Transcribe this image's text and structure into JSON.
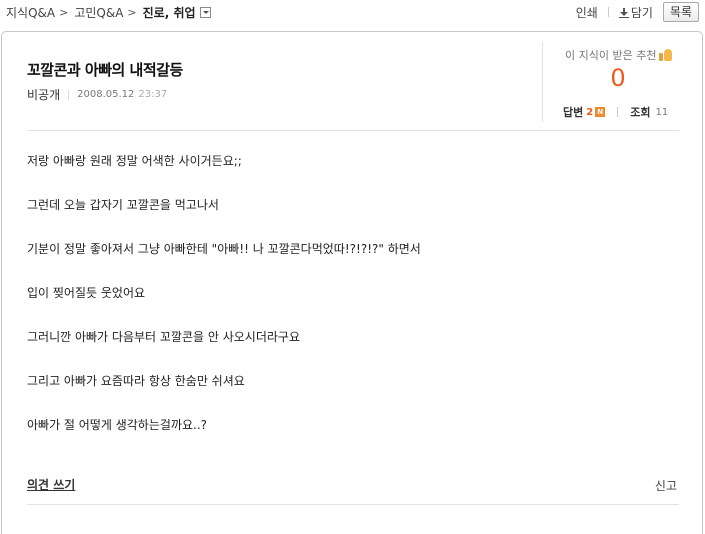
{
  "breadcrumb": {
    "items": [
      "지식Q&A",
      "고민Q&A"
    ],
    "separator": ">",
    "current": "진로, 취업"
  },
  "tools": {
    "print_label": "인쇄",
    "save_label": "담기",
    "list_label": "목록"
  },
  "question": {
    "title": "꼬깔콘과 아빠의 내적갈등",
    "author": "비공개",
    "date": "2008.05.12",
    "time": "23:37"
  },
  "recommend": {
    "label": "이 지식이 받은 추천",
    "count": "0",
    "answers_label": "답변",
    "answers_count": "2",
    "new_badge": "N",
    "views_label": "조회",
    "views_count": "11"
  },
  "body": {
    "paragraphs": [
      "저랑 아빠랑 원래 정말 어색한 사이거든요;;",
      "그런데 오늘 갑자기 꼬깔콘을 먹고나서",
      "기분이 정말 좋아져서 그냥 아빠한테 \"아빠!! 나 꼬깔콘다먹었따!?!?!?\" 하면서",
      "입이 찢어질듯 웃었어요",
      "그러니깐 아빠가 다음부터 꼬깔콘을 안 사오시더라구요",
      "그리고 아빠가 요즘따라 항상 한숨만 쉬셔요",
      "아빠가 절 어떻게 생각하는걸까요..?"
    ]
  },
  "footer": {
    "opinion_label": "의견 쓰기",
    "report_label": "신고"
  },
  "colors": {
    "accent_orange": "#f05a1a",
    "border": "#c8c8c8"
  }
}
